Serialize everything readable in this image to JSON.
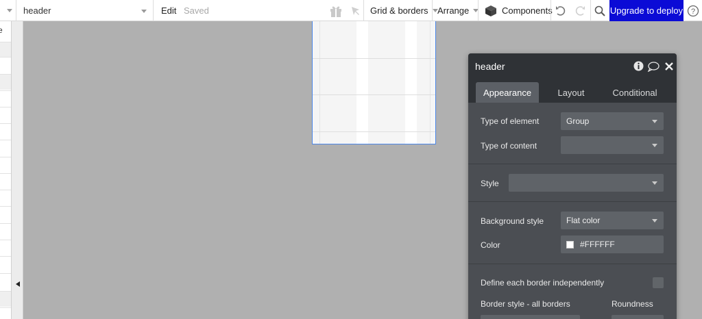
{
  "toolbar": {
    "page_selector": {
      "value": "header"
    },
    "edit_label": "Edit",
    "saved_label": "Saved",
    "grid_borders_label": "Grid & borders",
    "arrange_label": "Arrange",
    "components_label": "Components",
    "deploy_label": "Upgrade to deploy",
    "icons": [
      "caret-down-icon",
      "gift-icon",
      "pointer-icon",
      "cube-icon",
      "undo-icon",
      "redo-icon",
      "search-icon",
      "help-icon"
    ],
    "accent_color": "#0b0bd6"
  },
  "left_strip": {
    "clipped_text": "e",
    "collapse_icon": "caret-left-icon"
  },
  "panel": {
    "title": "header",
    "header_icons": [
      "info-icon",
      "comment-icon",
      "close-icon"
    ],
    "tabs": [
      {
        "label": "Appearance",
        "active": true
      },
      {
        "label": "Layout",
        "active": false
      },
      {
        "label": "Conditional",
        "active": false
      }
    ],
    "type_of_element": {
      "label": "Type of element",
      "value": "Group"
    },
    "type_of_content": {
      "label": "Type of content",
      "value": ""
    },
    "style": {
      "label": "Style",
      "value": ""
    },
    "background_style": {
      "label": "Background style",
      "value": "Flat color"
    },
    "color": {
      "label": "Color",
      "value": "#FFFFFF"
    },
    "define_borders": {
      "label": "Define each border independently",
      "checked": false
    },
    "border_style": {
      "label": "Border style - all borders"
    },
    "roundness": {
      "label": "Roundness"
    }
  }
}
